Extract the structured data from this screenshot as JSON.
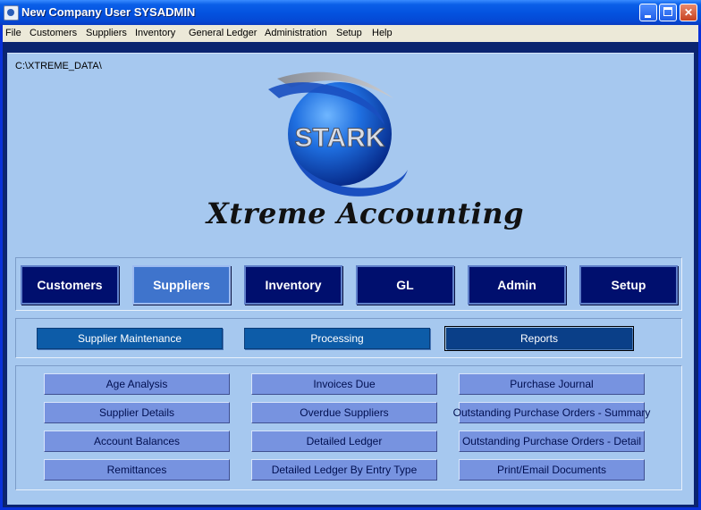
{
  "window": {
    "title": "New Company  User SYSADMIN"
  },
  "menu": [
    "File",
    "Customers",
    "Suppliers",
    "Inventory",
    "General Ledger",
    "Administration",
    "Setup",
    "Help"
  ],
  "path": "C:\\XTREME_DATA\\",
  "logo": {
    "globe_text": "STARK",
    "brand_text": "Xtreme Accounting"
  },
  "modules": [
    "Customers",
    "Suppliers",
    "Inventory",
    "GL",
    "Admin",
    "Setup"
  ],
  "active_module": "Suppliers",
  "submenu": [
    "Supplier Maintenance",
    "Processing",
    "Reports"
  ],
  "active_submenu": "Reports",
  "reports": [
    [
      "Age Analysis",
      "Invoices Due",
      "Purchase Journal"
    ],
    [
      "Supplier Details",
      "Overdue Suppliers",
      "Outstanding Purchase Orders - Summary"
    ],
    [
      "Account Balances",
      "Detailed Ledger",
      "Outstanding Purchase Orders - Detail"
    ],
    [
      "Remittances",
      "Detailed Ledger By Entry Type",
      "Print/Email Documents"
    ]
  ],
  "colors": {
    "titlebar": "#0453e0",
    "background": "#a6c8ef",
    "module_button": "#000f6e",
    "module_active": "#3f74cc",
    "report_button": "#7793e0"
  }
}
